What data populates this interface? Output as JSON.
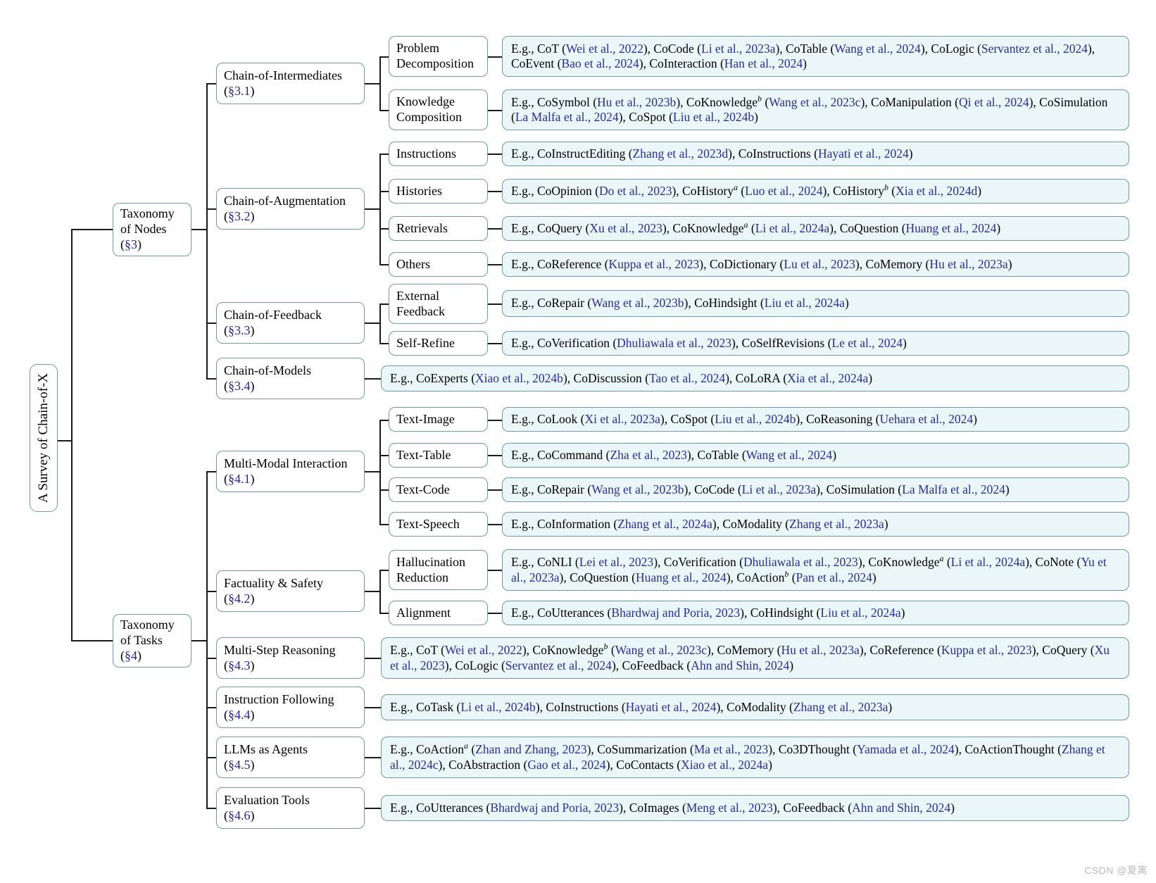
{
  "title": "A Survey of Chain-of-X taxonomy tree",
  "root": {
    "label": "A Survey of Chain-of-X"
  },
  "branches": [
    {
      "id": "taxonomy-of-nodes",
      "label": "Taxonomy\nof Nodes",
      "section": "(§3)"
    },
    {
      "id": "taxonomy-of-tasks",
      "label": "Taxonomy\nof Tasks",
      "section": "(§4)"
    }
  ],
  "categories": [
    {
      "id": "chain-of-intermediates",
      "label": "Chain-of-Intermediates",
      "section": "(§3.1)"
    },
    {
      "id": "chain-of-augmentation",
      "label": "Chain-of-Augmentation",
      "section": "(§3.2)"
    },
    {
      "id": "chain-of-feedback",
      "label": "Chain-of-Feedback",
      "section": "(§3.3)"
    },
    {
      "id": "chain-of-models",
      "label": "Chain-of-Models",
      "section": "(§3.4)"
    },
    {
      "id": "multi-modal-interaction",
      "label": "Multi-Modal Interaction",
      "section": "(§4.1)"
    },
    {
      "id": "factuality-and-safety",
      "label": "Factuality & Safety",
      "section": "(§4.2)"
    },
    {
      "id": "multi-step-reasoning",
      "label": "Multi-Step Reasoning",
      "section": "(§4.3)"
    },
    {
      "id": "instruction-following",
      "label": "Instruction Following",
      "section": "(§4.4)"
    },
    {
      "id": "llms-as-agents",
      "label": "LLMs as Agents",
      "section": "(§4.5)"
    },
    {
      "id": "evaluation-tools",
      "label": "Evaluation Tools",
      "section": "(§4.6)"
    }
  ],
  "subcategories": [
    {
      "id": "problem-decomposition",
      "label": "Problem\nDecomposition"
    },
    {
      "id": "knowledge-composition",
      "label": "Knowledge\nComposition"
    },
    {
      "id": "instructions",
      "label": "Instructions"
    },
    {
      "id": "histories",
      "label": "Histories"
    },
    {
      "id": "retrievals",
      "label": "Retrievals"
    },
    {
      "id": "others",
      "label": "Others"
    },
    {
      "id": "external-feedback",
      "label": "External\nFeedback"
    },
    {
      "id": "self-refine",
      "label": "Self-Refine"
    },
    {
      "id": "text-image",
      "label": "Text-Image"
    },
    {
      "id": "text-table",
      "label": "Text-Table"
    },
    {
      "id": "text-code",
      "label": "Text-Code"
    },
    {
      "id": "text-speech",
      "label": "Text-Speech"
    },
    {
      "id": "hallucination-reduction",
      "label": "Hallucination\nReduction"
    },
    {
      "id": "alignment",
      "label": "Alignment"
    }
  ],
  "leaves": {
    "problem_decomposition": "E.g., CoT (Wei et al., 2022), CoCode (Li et al., 2023a), CoTable (Wang et al., 2024), CoLogic (Servantez et al., 2024), CoEvent (Bao et al., 2024), CoInteraction (Han et al., 2024)",
    "knowledge_composition": "E.g., CoSymbol (Hu et al., 2023b), CoKnowledge^b (Wang et al., 2023c), CoManipulation (Qi et al., 2024), CoSimulation (La Malfa et al., 2024), CoSpot (Liu et al., 2024b)",
    "instructions": "E.g., CoInstructEditing (Zhang et al., 2023d), CoInstructions (Hayati et al., 2024)",
    "histories": "E.g., CoOpinion (Do et al., 2023), CoHistory^a (Luo et al., 2024), CoHistory^b (Xia et al., 2024d)",
    "retrievals": "E.g., CoQuery (Xu et al., 2023), CoKnowledge^a (Li et al., 2024a), CoQuestion (Huang et al., 2024)",
    "others": "E.g., CoReference (Kuppa et al., 2023), CoDictionary (Lu et al., 2023), CoMemory (Hu et al., 2023a)",
    "external_feedback": "E.g., CoRepair (Wang et al., 2023b), CoHindsight (Liu et al., 2024a)",
    "self_refine": "E.g., CoVerification (Dhuliawala et al., 2023), CoSelfRevisions (Le et al., 2024)",
    "chain_of_models": "E.g., CoExperts (Xiao et al., 2024b), CoDiscussion (Tao et al., 2024), CoLoRA (Xia et al., 2024a)",
    "text_image": "E.g., CoLook (Xi et al., 2023a), CoSpot (Liu et al., 2024b), CoReasoning (Uehara et al., 2024)",
    "text_table": "E.g., CoCommand (Zha et al., 2023), CoTable (Wang et al., 2024)",
    "text_code": "E.g., CoRepair (Wang et al., 2023b), CoCode (Li et al., 2023a), CoSimulation (La Malfa et al., 2024)",
    "text_speech": "E.g., CoInformation (Zhang et al., 2024a), CoModality (Zhang et al., 2023a)",
    "hallucination_reduction": "E.g., CoNLI (Lei et al., 2023), CoVerification (Dhuliawala et al., 2023), CoKnowledge^a (Li et al., 2024a), CoNote (Yu et al., 2023a), CoQuestion (Huang et al., 2024), CoAction^b (Pan et al., 2024)",
    "alignment": "E.g., CoUtterances (Bhardwaj and Poria, 2023), CoHindsight (Liu et al., 2024a)",
    "multi_step_reasoning": "E.g., CoT (Wei et al., 2022), CoKnowledge^b (Wang et al., 2023c), CoMemory (Hu et al., 2023a), CoReference (Kuppa et al., 2023), CoQuery (Xu et al., 2023), CoLogic (Servantez et al., 2024), CoFeedback (Ahn and Shin, 2024)",
    "instruction_following": "E.g., CoTask (Li et al., 2024b), CoInstructions (Hayati et al., 2024), CoModality (Zhang et al., 2023a)",
    "llms_as_agents": "E.g., CoAction^a (Zhan and Zhang, 2023), CoSummarization (Ma et al., 2023), Co3DThought (Yamada et al., 2024), CoActionThought (Zhang et al., 2024c), CoAbstraction (Gao et al., 2024), CoContacts (Xiao et al., 2024a)",
    "evaluation_tools": "E.g., CoUtterances (Bhardwaj and Poria, 2023), CoImages (Meng et al., 2023), CoFeedback (Ahn and Shin, 2024)"
  },
  "watermark": "CSDN @夏离",
  "colors": {
    "border": "#6f9ba0",
    "leaf_fill": "#eaf6f7",
    "node_fill": "#ffffff",
    "citation": "#2b2b9e",
    "section": "#24249b",
    "line": "#1a1a1a"
  }
}
